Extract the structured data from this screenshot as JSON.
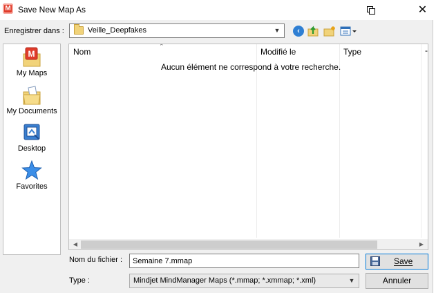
{
  "window": {
    "title": "Save New Map As",
    "app_icon_letter": "M",
    "close_glyph": "✕"
  },
  "lookin": {
    "label": "Enregistrer dans :",
    "value": "Veille_Deepfakes",
    "toolbar_icons": [
      "back-icon",
      "up-folder-icon",
      "new-folder-icon",
      "view-menu-icon"
    ]
  },
  "places": [
    {
      "label": "My Maps",
      "icon": "my-maps-icon"
    },
    {
      "label": "My Documents",
      "icon": "my-documents-icon"
    },
    {
      "label": "Desktop",
      "icon": "desktop-icon"
    },
    {
      "label": "Favorites",
      "icon": "favorites-icon"
    }
  ],
  "filelist": {
    "columns": [
      "Nom",
      "Modifié le",
      "Type",
      "-"
    ],
    "empty_message": "Aucun élément ne correspond à votre recherche."
  },
  "filename": {
    "label": "Nom du fichier :",
    "value": "Semaine 7.mmap"
  },
  "filetype": {
    "label": "Type :",
    "value": "Mindjet MindManager Maps (*.mmap; *.xmmap; *.xml)"
  },
  "buttons": {
    "save": "Save",
    "cancel": "Annuler"
  },
  "colors": {
    "accent": "#0078d7",
    "brand_red": "#e03c2b"
  }
}
